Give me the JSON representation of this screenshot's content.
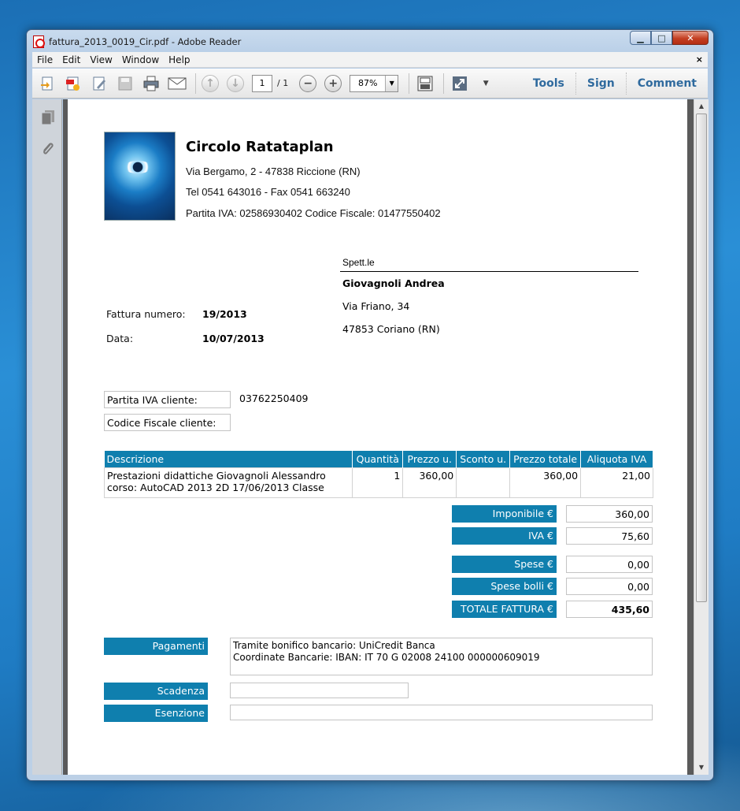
{
  "window": {
    "title": "fattura_2013_0019_Cir.pdf - Adobe Reader",
    "controls": {
      "minimize": "▁",
      "maximize": "□",
      "close": "✕"
    }
  },
  "menubar": {
    "items": [
      "File",
      "Edit",
      "View",
      "Window",
      "Help"
    ],
    "close_glyph": "×"
  },
  "toolbar": {
    "page_current": "1",
    "page_total": "/ 1",
    "zoom": "87%",
    "links": [
      "Tools",
      "Sign",
      "Comment"
    ],
    "icons": [
      "open-icon",
      "create-pdf-icon",
      "edit-icon",
      "save-icon",
      "print-icon",
      "email-icon",
      "prev-page-icon",
      "next-page-icon",
      "zoom-out-icon",
      "zoom-in-icon",
      "fit-page-icon",
      "fullscreen-icon",
      "toolbar-menu-icon"
    ]
  },
  "left_pane": {
    "icons": [
      "pages-icon",
      "attachments-icon"
    ]
  },
  "invoice": {
    "company": {
      "name": "Circolo Ratataplan",
      "address": "Via Bergamo, 2 - 47838 Riccione (RN)",
      "phone": "Tel 0541 643016 - Fax 0541 663240",
      "tax": "Partita IVA: 02586930402 Codice Fiscale: 01477550402"
    },
    "recipient": {
      "salutation": "Spett.le",
      "name": "Giovagnoli Andrea",
      "street": "Via Friano, 34",
      "city": "47853 Coriano (RN)"
    },
    "number_label": "Fattura numero:",
    "number": "19/2013",
    "date_label": "Data:",
    "date": "10/07/2013",
    "piva_label": "Partita IVA cliente:",
    "piva_value": "03762250409",
    "cf_label": "Codice Fiscale cliente:",
    "cf_value": "",
    "table": {
      "headers": [
        "Descrizione",
        "Quantità",
        "Prezzo u.",
        "Sconto u.",
        "Prezzo totale",
        "Aliquota IVA"
      ],
      "rows": [
        {
          "descrizione": "Prestazioni didattiche Giovagnoli Alessandro corso: AutoCAD 2013 2D 17/06/2013 Classe",
          "quantita": "1",
          "prezzo_u": "360,00",
          "sconto_u": "",
          "prezzo_totale": "360,00",
          "aliquota": "21,00"
        }
      ]
    },
    "totals": {
      "imponibile_label": "Imponibile €",
      "imponibile": "360,00",
      "iva_label": "IVA €",
      "iva": "75,60",
      "spese_label": "Spese €",
      "spese": "0,00",
      "bolli_label": "Spese bolli €",
      "bolli": "0,00",
      "totale_label": "TOTALE FATTURA €",
      "totale": "435,60"
    },
    "payment": {
      "label": "Pagamenti",
      "line1": "Tramite bonifico bancario: UniCredit Banca",
      "line2": "Coordinate Bancarie: IBAN: IT 70 G 02008 24100 000000609019",
      "scadenza_label": "Scadenza",
      "esenzione_label": "Esenzione"
    }
  }
}
